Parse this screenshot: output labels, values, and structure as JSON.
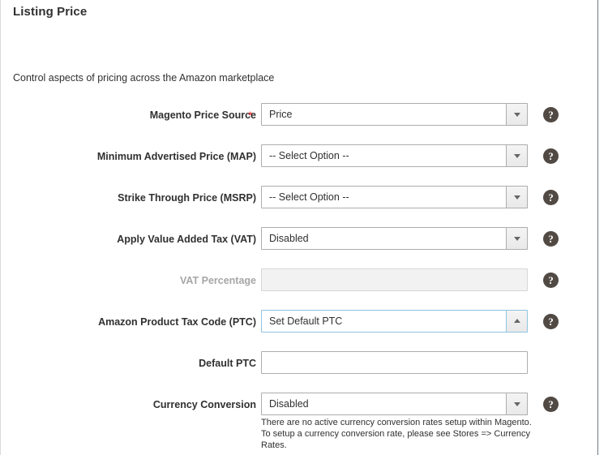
{
  "page": {
    "title": "Listing Price",
    "description": "Control aspects of pricing across the Amazon marketplace"
  },
  "icons": {
    "help": "?",
    "required_marker": "*"
  },
  "colors": {
    "required_asterisk": "#e22626",
    "help_icon_bg": "#514943",
    "focus_border": "#8fc4e0",
    "field_border": "#adadad",
    "disabled_bg": "#f2f2f2",
    "text": "#303030",
    "disabled_text": "#a6a6a6"
  },
  "form": {
    "fields": [
      {
        "label": "Magento Price Source",
        "value": "Price",
        "placeholder": "",
        "required": true,
        "control": "select",
        "state": "default",
        "arrow": "down",
        "help": true,
        "note": ""
      },
      {
        "label": "Minimum Advertised Price (MAP)",
        "value": "-- Select Option --",
        "placeholder": "-- Select Option --",
        "required": false,
        "control": "select",
        "state": "default",
        "arrow": "down",
        "help": true,
        "note": ""
      },
      {
        "label": "Strike Through Price (MSRP)",
        "value": "-- Select Option --",
        "placeholder": "-- Select Option --",
        "required": false,
        "control": "select",
        "state": "default",
        "arrow": "down",
        "help": true,
        "note": ""
      },
      {
        "label": "Apply Value Added Tax (VAT)",
        "value": "Disabled",
        "placeholder": "",
        "required": false,
        "control": "select",
        "state": "default",
        "arrow": "down",
        "help": true,
        "note": ""
      },
      {
        "label": "VAT Percentage",
        "value": "",
        "placeholder": "",
        "required": false,
        "control": "text",
        "state": "disabled",
        "arrow": "none",
        "help": true,
        "note": ""
      },
      {
        "label": "Amazon Product Tax Code (PTC)",
        "value": "Set Default PTC",
        "placeholder": "",
        "required": false,
        "control": "select",
        "state": "focused",
        "arrow": "up",
        "help": true,
        "note": ""
      },
      {
        "label": "Default PTC",
        "value": "",
        "placeholder": "",
        "required": false,
        "control": "text",
        "state": "default",
        "arrow": "none",
        "help": false,
        "note": ""
      },
      {
        "label": "Currency Conversion",
        "value": "Disabled",
        "placeholder": "",
        "required": false,
        "control": "select",
        "state": "default",
        "arrow": "down",
        "help": true,
        "note": "There are no active currency conversion rates setup within Magento. To setup a currency conversion rate, please see Stores => Currency Rates."
      }
    ]
  }
}
